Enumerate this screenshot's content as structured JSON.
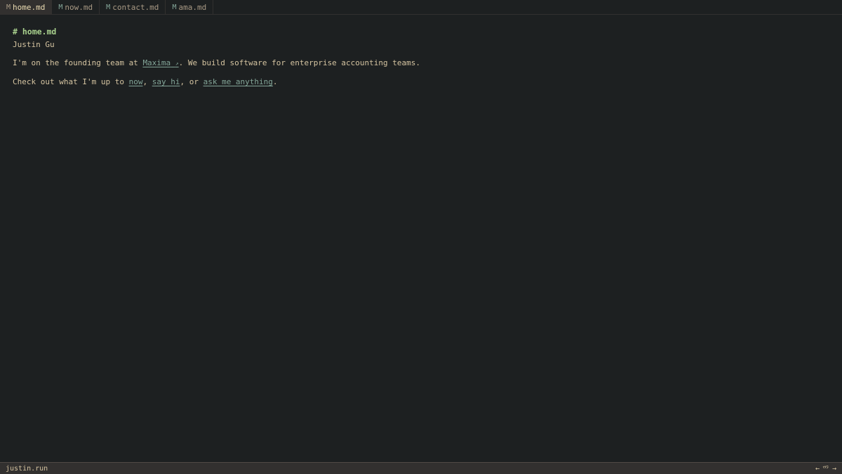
{
  "tabs": [
    {
      "mark": "M",
      "label": "home.md",
      "active": true
    },
    {
      "mark": "M",
      "label": "now.md",
      "active": false
    },
    {
      "mark": "M",
      "label": "contact.md",
      "active": false
    },
    {
      "mark": "M",
      "label": "ama.md",
      "active": false
    }
  ],
  "content": {
    "heading": "# home.md",
    "name": "Justin Gu",
    "p1_before": "I'm on the founding team at ",
    "p1_link": "Maxima",
    "p1_link_icon": "↗",
    "p1_after": ". We build software for enterprise accounting teams.",
    "p2_before": "Check out what I'm up to ",
    "p2_link1": "now",
    "p2_sep1": ", ",
    "p2_link2": "say hi",
    "p2_sep2": ", or ",
    "p2_link3": "ask me anything",
    "p2_after": "."
  },
  "status": {
    "site": "justin.run",
    "prev": "←",
    "logo": "爫",
    "next": "→"
  },
  "colors": {
    "background": "#1d2021",
    "accent_link": "#83a598",
    "heading": "#a9d18e"
  }
}
